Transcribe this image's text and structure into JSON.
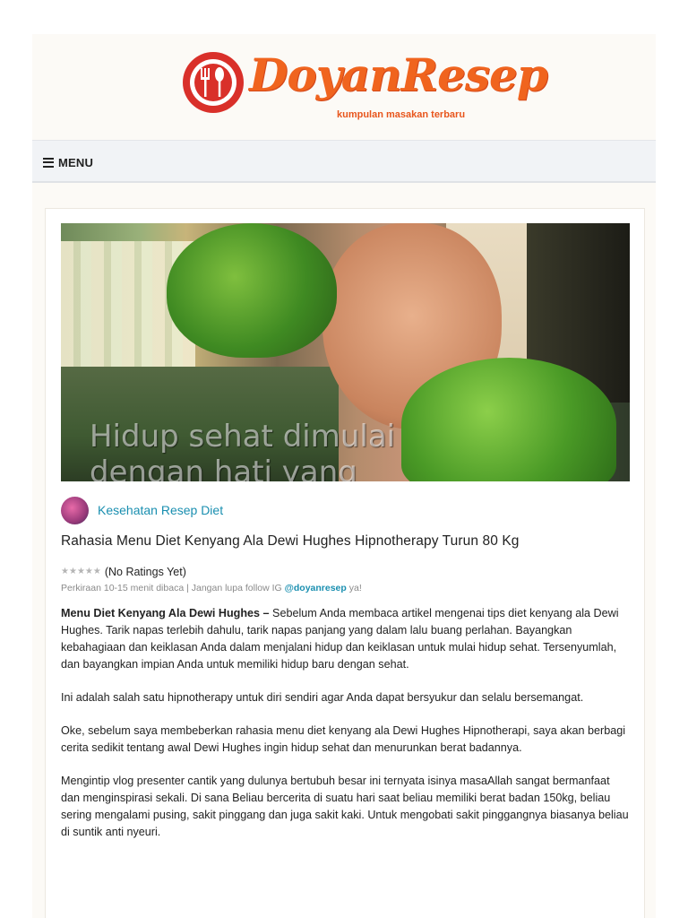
{
  "header": {
    "logo_name": "DoyanResep",
    "logo_tagline": "kumpulan masakan terbaru",
    "brand_color": "#f0641e",
    "badge_color": "#d9302a"
  },
  "nav": {
    "menu_label": "MENU",
    "menu_icon": "hamburger-icon"
  },
  "article": {
    "hero_caption_line1": "Hidup sehat dimulai",
    "hero_caption_line2": "dengan hati yang",
    "category": "Kesehatan Resep Diet",
    "title": "Rahasia Menu Diet Kenyang Ala Dewi Hughes Hipnotherapy Turun 80 Kg",
    "rating_text": "(No Ratings Yet)",
    "meta_prefix": "Perkiraan 10-15 menit dibaca | Jangan lupa follow IG ",
    "meta_ig": "@doyanresep",
    "meta_suffix": " ya!",
    "lead_bold": "Menu Diet Kenyang Ala Dewi Hughes –",
    "lead_text": " Sebelum Anda membaca artikel mengenai tips diet kenyang ala Dewi Hughes. Tarik napas terlebih dahulu, tarik napas panjang yang dalam lalu buang perlahan. Bayangkan kebahagiaan dan keiklasan Anda dalam menjalani hidup dan keiklasan untuk mulai hidup sehat. Tersenyumlah, dan bayangkan impian Anda untuk memiliki hidup baru dengan sehat.",
    "paragraphs": [
      "Ini adalah salah satu hipnotherapy untuk diri sendiri agar Anda dapat bersyukur dan selalu bersemangat.",
      "Oke, sebelum saya membeberkan rahasia menu diet kenyang ala Dewi Hughes Hipnotherapi, saya akan berbagi cerita sedikit tentang awal Dewi Hughes ingin hidup sehat dan menurunkan berat badannya.",
      "Mengintip vlog presenter cantik yang dulunya bertubuh besar ini ternyata isinya masaAllah sangat bermanfaat dan menginspirasi sekali. Di sana Beliau bercerita di suatu hari saat beliau memiliki berat badan 150kg, beliau sering mengalami pusing, sakit pinggang dan juga sakit kaki. Untuk mengobati sakit pinggangnya biasanya beliau di suntik anti nyeuri."
    ],
    "link_color": "#1a8fb0"
  }
}
